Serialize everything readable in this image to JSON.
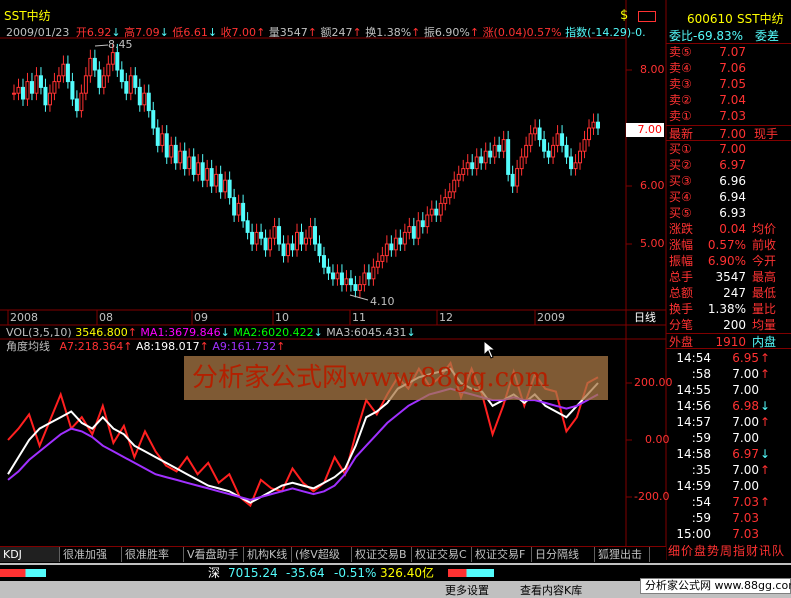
{
  "chart": {
    "title": "SST中纺",
    "info_date": "2009/01/23",
    "info_open": "开6.92",
    "info_high": "高7.09",
    "info_low": "低6.61",
    "info_close": "收7.00",
    "info_vol": "量3547",
    "info_amount": "额247",
    "info_turnover": "换1.38%",
    "info_amplitude": "振6.90%",
    "info_change": "涨(0.04)0.57%",
    "info_index": "指数(-14.29)-0.",
    "price_axis": [
      "8.00",
      "7.00",
      "6.00",
      "5.00"
    ],
    "current_price_tag": "7.00",
    "high_label": "8.45",
    "low_label": "4.10",
    "date_axis": [
      "2008",
      "08",
      "09",
      "10",
      "11",
      "12",
      "2009"
    ],
    "period": "日线",
    "vol_line_label": "VOL(3,5,10)",
    "vol_value": "3546.800",
    "ma1": "MA1:3679.846",
    "ma2": "MA2:6020.422",
    "ma3": "MA3:6045.431",
    "indicator_name": "角度均线",
    "a7": "A7:218.364",
    "a8": "A8:198.017",
    "a9": "A9:161.732",
    "indicator_axis": [
      "200.00",
      "0.00",
      "-200.0"
    ],
    "watermark": "分析家公式网www.88gg.com"
  },
  "chart_data": {
    "type": "line",
    "title": "角度均线",
    "series": [
      {
        "name": "A7",
        "values": [
          0,
          40,
          90,
          -20,
          70,
          160,
          40,
          80,
          20,
          120,
          -10,
          50,
          -60,
          30,
          -40,
          -90,
          -110,
          -60,
          -120,
          -80,
          -150,
          -120,
          -200,
          -230,
          -140,
          -170,
          -180,
          -100,
          -150,
          -180,
          -150,
          -60,
          -120,
          20,
          140,
          90,
          160,
          220,
          180,
          250,
          190,
          220,
          270,
          150,
          250,
          160,
          20,
          120,
          240,
          120,
          230,
          180,
          170,
          30,
          80,
          200,
          220
        ]
      },
      {
        "name": "A8",
        "values": [
          -120,
          -60,
          0,
          40,
          60,
          80,
          100,
          60,
          40,
          80,
          40,
          20,
          -20,
          -40,
          -60,
          -80,
          -100,
          -120,
          -140,
          -160,
          -170,
          -180,
          -200,
          -220,
          -200,
          -180,
          -160,
          -150,
          -160,
          -170,
          -150,
          -130,
          -100,
          -20,
          80,
          100,
          130,
          180,
          200,
          220,
          230,
          240,
          250,
          200,
          180,
          170,
          120,
          140,
          160,
          130,
          160,
          120,
          100,
          80,
          120,
          160,
          200
        ]
      },
      {
        "name": "A9",
        "values": [
          -140,
          -110,
          -70,
          -40,
          -10,
          20,
          40,
          30,
          10,
          -20,
          -40,
          -60,
          -80,
          -100,
          -120,
          -130,
          -140,
          -150,
          -160,
          -170,
          -180,
          -190,
          -200,
          -210,
          -200,
          -190,
          -180,
          -170,
          -180,
          -190,
          -180,
          -160,
          -120,
          -60,
          -20,
          20,
          60,
          90,
          120,
          140,
          160,
          170,
          180,
          170,
          160,
          150,
          140,
          140,
          150,
          140,
          140,
          130,
          120,
          110,
          120,
          140,
          160
        ]
      }
    ],
    "ylim": [
      -280,
      280
    ]
  },
  "quote": {
    "code": "600610",
    "name": "SST中纺",
    "weibi_label": "委比",
    "weibi_value": "-69.83%",
    "weicha_label": "委差",
    "sell": [
      {
        "label": "卖⑤",
        "price": "7.07"
      },
      {
        "label": "卖④",
        "price": "7.06"
      },
      {
        "label": "卖③",
        "price": "7.05"
      },
      {
        "label": "卖②",
        "price": "7.04"
      },
      {
        "label": "卖①",
        "price": "7.03"
      }
    ],
    "last_label": "最新",
    "last_price": "7.00",
    "last_right": "现手",
    "buy": [
      {
        "label": "买①",
        "price": "7.00"
      },
      {
        "label": "买②",
        "price": "6.97"
      },
      {
        "label": "买③",
        "price": "6.96"
      },
      {
        "label": "买④",
        "price": "6.94"
      },
      {
        "label": "买⑤",
        "price": "6.93"
      }
    ],
    "stats": [
      {
        "label": "涨跌",
        "value": "0.04",
        "right": "均价"
      },
      {
        "label": "涨幅",
        "value": "0.57%",
        "right": "前收"
      },
      {
        "label": "振幅",
        "value": "6.90%",
        "right": "今开"
      },
      {
        "label": "总手",
        "value": "3547",
        "right": "最高"
      },
      {
        "label": "总额",
        "value": "247",
        "right": "最低"
      },
      {
        "label": "换手",
        "value": "1.38%",
        "right": "量比"
      },
      {
        "label": "分笔",
        "value": "200",
        "right": "均量"
      }
    ],
    "outer_label": "外盘",
    "outer_value": "1910",
    "inner_label": "内盘",
    "ticks": [
      {
        "time": "14:54",
        "price": "6.95",
        "dir": "↑"
      },
      {
        "time": ":58",
        "price": "7.00",
        "dir": "↑"
      },
      {
        "time": "14:55",
        "price": "7.00",
        "dir": ""
      },
      {
        "time": "14:56",
        "price": "6.98",
        "dir": "↓"
      },
      {
        "time": "14:57",
        "price": "7.00",
        "dir": "↑"
      },
      {
        "time": ":59",
        "price": "7.00",
        "dir": ""
      },
      {
        "time": "14:58",
        "price": "6.97",
        "dir": "↓"
      },
      {
        "time": ":35",
        "price": "7.00",
        "dir": "↑"
      },
      {
        "time": "14:59",
        "price": "7.00",
        "dir": ""
      },
      {
        "time": ":54",
        "price": "7.03",
        "dir": "↑"
      },
      {
        "time": ":59",
        "price": "7.03",
        "dir": ""
      },
      {
        "time": "15:00",
        "price": "7.03",
        "dir": ""
      }
    ],
    "bottom_tabs": "细价盘势周指财讯队"
  },
  "tabs": [
    "KDJ",
    "很准加强",
    "很准胜率",
    "V看盘助手",
    "机构K线",
    "(修V超级MACD)",
    "权证交易B",
    "权证交易C",
    "权证交易F",
    "日分隔线",
    "狐狸出击"
  ],
  "status": {
    "index_name": "深",
    "index_value": "7015.24",
    "index_change": "-35.64",
    "index_pct": "-0.51%",
    "index_amount": "326.40亿",
    "site": "分析家公式网 www.88gg.com",
    "btn1": "更多设置",
    "btn2": "查看内容K库"
  },
  "colors": {
    "up": "#ff3232",
    "down": "#54fcfc",
    "white": "#ffffff",
    "purple": "#a030ff",
    "yellow": "#ffff00",
    "grid": "#800000"
  }
}
